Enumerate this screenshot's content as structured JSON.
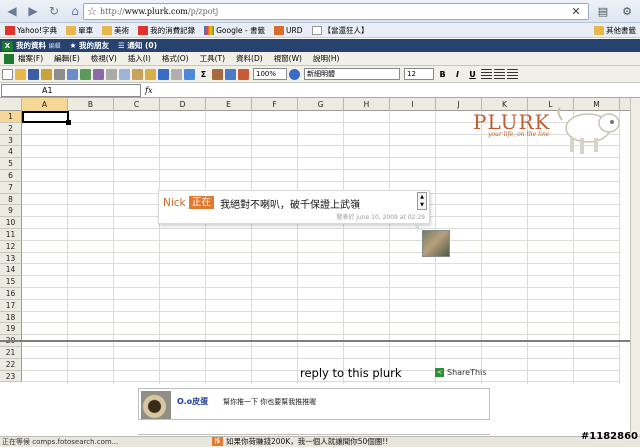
{
  "browser": {
    "url_prefix": "http://",
    "url_host": "www.plurk.com",
    "url_path": "/p/zpotj",
    "bookmarks": [
      {
        "label": "Yahoo!字典",
        "icon": "yahoo-icon"
      },
      {
        "label": "單車",
        "icon": "folder-icon"
      },
      {
        "label": "美術",
        "icon": "folder-icon"
      },
      {
        "label": "我的消費記錄",
        "icon": "yahoo-icon"
      },
      {
        "label": "Google - 書籤",
        "icon": "google-icon"
      },
      {
        "label": "URD",
        "icon": "page-icon"
      },
      {
        "label": "【當還狂人】",
        "icon": "page-icon"
      }
    ],
    "other_bookmarks": "其他書籤"
  },
  "plurk_bar": {
    "profile": "我的資料",
    "profile_sub": "編輯",
    "friends": "我的朋友",
    "notify": "通知 (0)"
  },
  "excel": {
    "menus": [
      "檔案(F)",
      "編輯(E)",
      "檢視(V)",
      "插入(I)",
      "格式(O)",
      "工具(T)",
      "資料(D)",
      "視窗(W)",
      "說明(H)"
    ],
    "zoom": "100%",
    "font": "新細明體",
    "font_size": "12",
    "bold": "B",
    "italic": "I",
    "underline": "U",
    "sigma": "Σ",
    "namebox": "A1",
    "fx": "fx",
    "columns": [
      "A",
      "B",
      "C",
      "D",
      "E",
      "F",
      "G",
      "H",
      "I",
      "J",
      "K",
      "L",
      "M"
    ],
    "rows": [
      "1",
      "2",
      "3",
      "4",
      "5",
      "6",
      "7",
      "8",
      "9",
      "10",
      "11",
      "12",
      "13",
      "14",
      "15",
      "16",
      "17",
      "18",
      "19",
      "20",
      "21",
      "22",
      "23"
    ],
    "status": "正在等候 comps.fotosearch.com..."
  },
  "plurk": {
    "logo": "PLURK",
    "tagline": "your life, on the line",
    "post": {
      "nick": "Nick",
      "qualifier": "正在",
      "message": "我絕對不喇叭，破千保證上武嶺",
      "meta": "發表於 june 10, 2009 at 02:29"
    },
    "reply_title": "reply to this plurk",
    "share_label": "ShareThis",
    "response": {
      "user": "O.o皮蛋",
      "text": "幫你推一下 你也要幫我推推喔"
    },
    "ad_text": "如果你荷賺錢200K，我一個人就讓聞你50個團!!"
  },
  "watermark": "#1182860",
  "colors": {
    "plurk_orange": "#e07a2f",
    "plurk_bar": "#27426f",
    "excel_green": "#1f7a31"
  }
}
